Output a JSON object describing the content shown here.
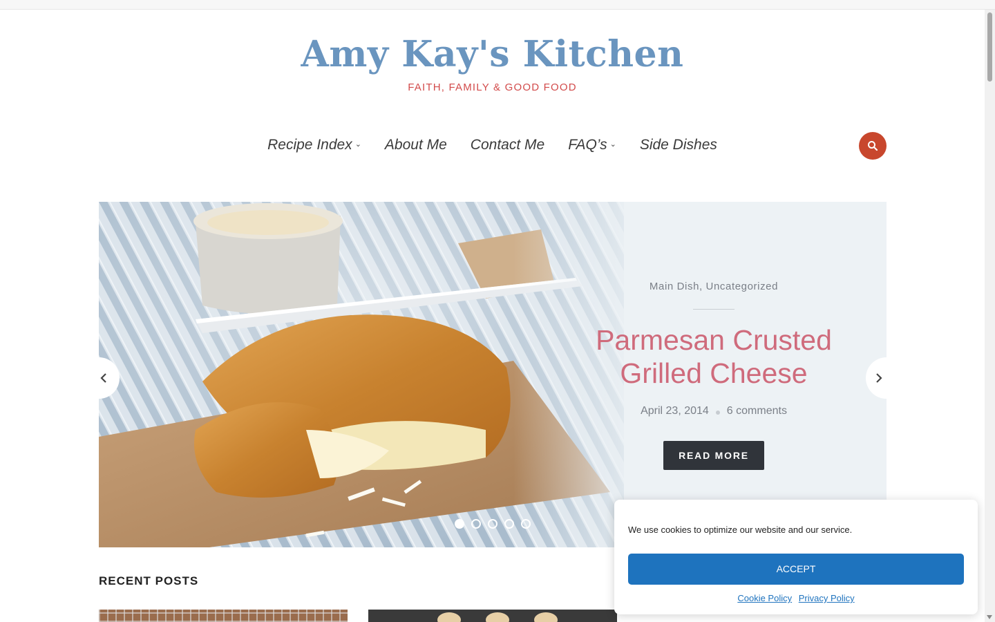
{
  "site": {
    "title": "Amy Kay's Kitchen",
    "tagline": "FAITH, FAMILY & GOOD FOOD",
    "title_color": "#6a95bf",
    "tagline_color": "#d24a4a"
  },
  "nav": {
    "items": [
      {
        "label": "Recipe Index",
        "has_dropdown": true
      },
      {
        "label": "About Me",
        "has_dropdown": false
      },
      {
        "label": "Contact Me",
        "has_dropdown": false
      },
      {
        "label": "FAQ’s",
        "has_dropdown": true
      },
      {
        "label": "Side Dishes",
        "has_dropdown": false
      }
    ],
    "search_icon": "search-icon",
    "search_color": "#c8472d"
  },
  "hero": {
    "categories": "Main Dish, Uncategorized",
    "title_line1": "Parmesan Crusted",
    "title_line2": "Grilled Cheese",
    "date": "April 23, 2014",
    "comments": "6 comments",
    "button_label": "READ MORE",
    "slide_count": 5,
    "active_slide": 1,
    "title_color": "#cf6b7c"
  },
  "recent": {
    "heading": "RECENT POSTS"
  },
  "cookie": {
    "message": "We use cookies to optimize our website and our service.",
    "accept_label": "ACCEPT",
    "cookie_policy": "Cookie Policy",
    "privacy_policy": "Privacy Policy",
    "accent": "#1e73be"
  }
}
